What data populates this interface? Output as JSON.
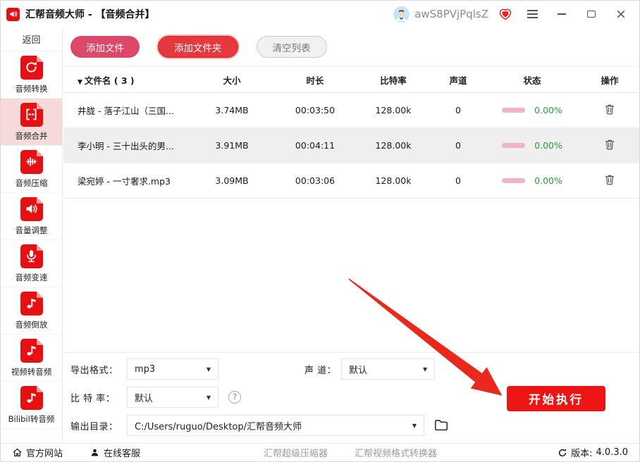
{
  "titlebar": {
    "app_title": "汇帮音频大师 - 【音频合并】",
    "username": "awS8PVjPqlsZ"
  },
  "sidebar": {
    "back_label": "返回",
    "items": [
      {
        "name": "sidebar-item-audio-convert",
        "label": "音频转换",
        "icon": "convert",
        "active": false
      },
      {
        "name": "sidebar-item-audio-merge",
        "label": "音频合并",
        "icon": "merge",
        "active": true
      },
      {
        "name": "sidebar-item-audio-compress",
        "label": "音频压缩",
        "icon": "compress",
        "active": false
      },
      {
        "name": "sidebar-item-volume-adjust",
        "label": "音量调整",
        "icon": "volume",
        "active": false
      },
      {
        "name": "sidebar-item-audio-speed",
        "label": "音频变速",
        "icon": "mic",
        "active": false
      },
      {
        "name": "sidebar-item-audio-reverse",
        "label": "音频倒放",
        "icon": "note",
        "active": false
      },
      {
        "name": "sidebar-item-video-to-audio",
        "label": "视频转音频",
        "icon": "note",
        "active": false
      },
      {
        "name": "sidebar-item-bilibili-to-audio",
        "label": "Bilibil转音频",
        "icon": "note",
        "active": false
      }
    ]
  },
  "toolbar": {
    "add_file_label": "添加文件",
    "add_folder_label": "添加文件夹",
    "clear_list_label": "清空列表"
  },
  "table": {
    "headers": {
      "filename": "文件名 ( 3 )",
      "size": "大小",
      "duration": "时长",
      "bitrate": "比特率",
      "channel": "声道",
      "status": "状态",
      "operation": "操作"
    },
    "rows": [
      {
        "name": "井胧 - 落子江山（三国...",
        "size": "3.74MB",
        "duration": "00:03:50",
        "bitrate": "128.00k",
        "channel": "0",
        "progress": "0.00%"
      },
      {
        "name": "李小明 - 三十出头的男...",
        "size": "3.91MB",
        "duration": "00:04:11",
        "bitrate": "128.00k",
        "channel": "0",
        "progress": "0.00%"
      },
      {
        "name": "梁宛婷 - 一寸奢求.mp3",
        "size": "3.09MB",
        "duration": "00:03:06",
        "bitrate": "128.00k",
        "channel": "0",
        "progress": "0.00%"
      }
    ]
  },
  "settings": {
    "export_format": {
      "label": "导出格式：",
      "value": "mp3"
    },
    "channel": {
      "label": "声 道：",
      "value": "默认"
    },
    "bitrate": {
      "label": "比 特 率：",
      "value": "默认"
    },
    "output_dir": {
      "label": "输出目录：",
      "value": "C:/Users/ruguo/Desktop/汇帮音频大师"
    },
    "start_label": "开始执行"
  },
  "footer": {
    "home_label": "官方网站",
    "service_label": "在线客服",
    "partner1": "汇帮超级压缩器",
    "partner2": "汇帮视频格式转换器",
    "version_label": "版本:",
    "version": "4.0.3.0"
  },
  "colors": {
    "accent_red": "#e60f12",
    "rose_button": "#dd4768",
    "folder_button_red": "#e5383f",
    "start_button_red": "#ec1515",
    "active_item_pink": "#f6dada",
    "progress_pink": "#f3b3c7",
    "progress_green": "#21a038",
    "vip_badge_red": "#e8261c",
    "arrow_red": "#e8291c"
  }
}
